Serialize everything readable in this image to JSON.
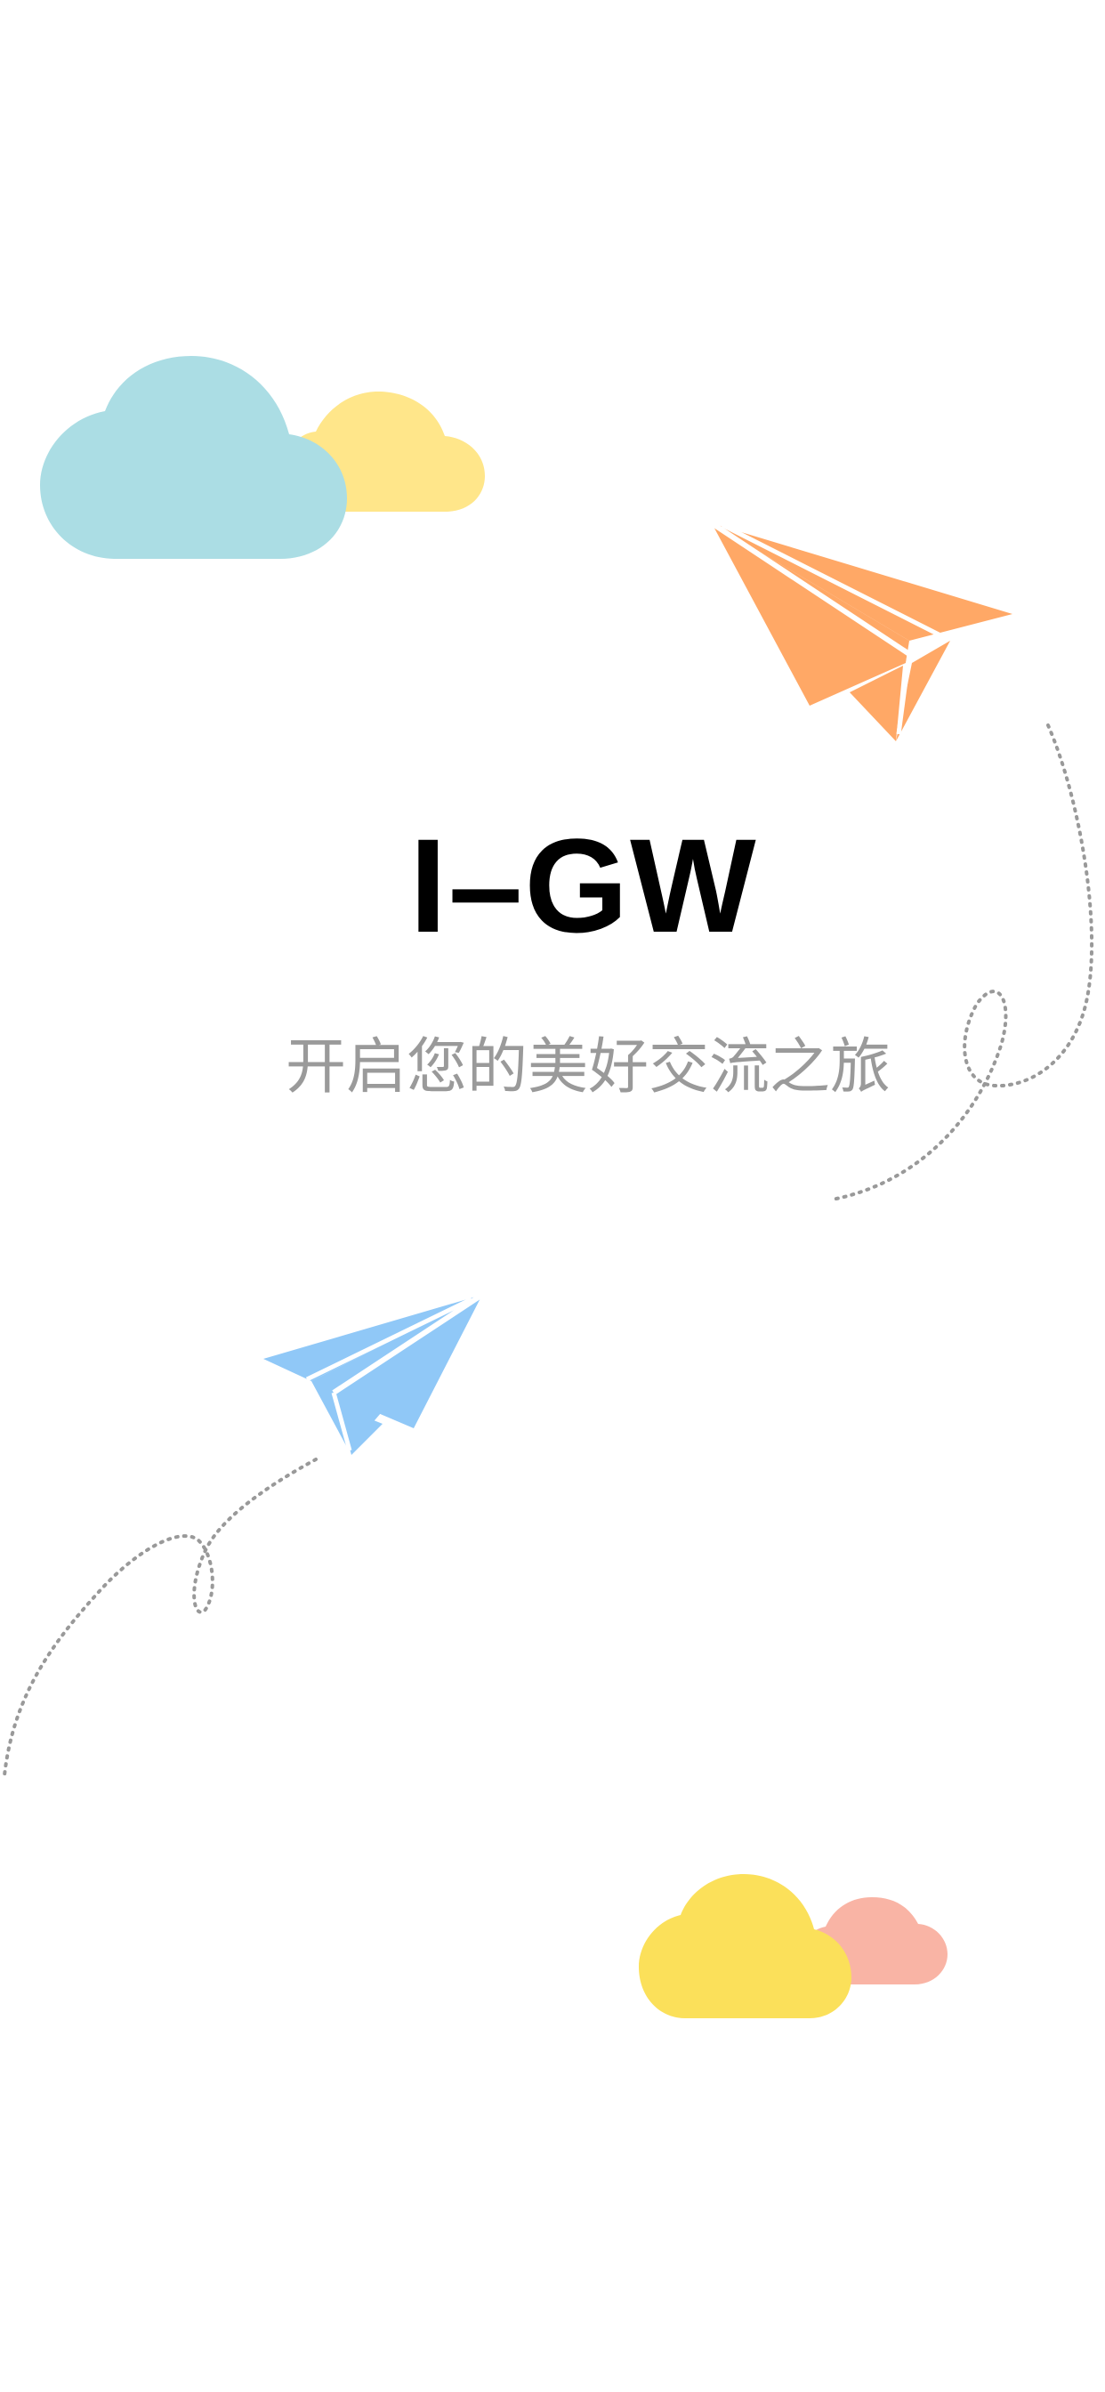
{
  "app": {
    "title": "I–GW",
    "tagline": "开启您的美好交流之旅"
  },
  "colors": {
    "background": "#ffffff",
    "title": "#000000",
    "tagline": "#9a9a9a",
    "cloud_blue": "#abdde4",
    "cloud_light_yellow": "#ffe68a",
    "cloud_yellow": "#fbe05a",
    "cloud_pink": "#f9b4a5",
    "plane_orange": "#ffa866",
    "plane_blue": "#90c8f7",
    "dotted_path": "#999999"
  },
  "decorations": {
    "top_clouds": [
      "cloud-icon",
      "cloud-icon"
    ],
    "bottom_clouds": [
      "cloud-icon",
      "cloud-icon"
    ],
    "planes": [
      "paper-plane-icon",
      "paper-plane-icon"
    ]
  }
}
